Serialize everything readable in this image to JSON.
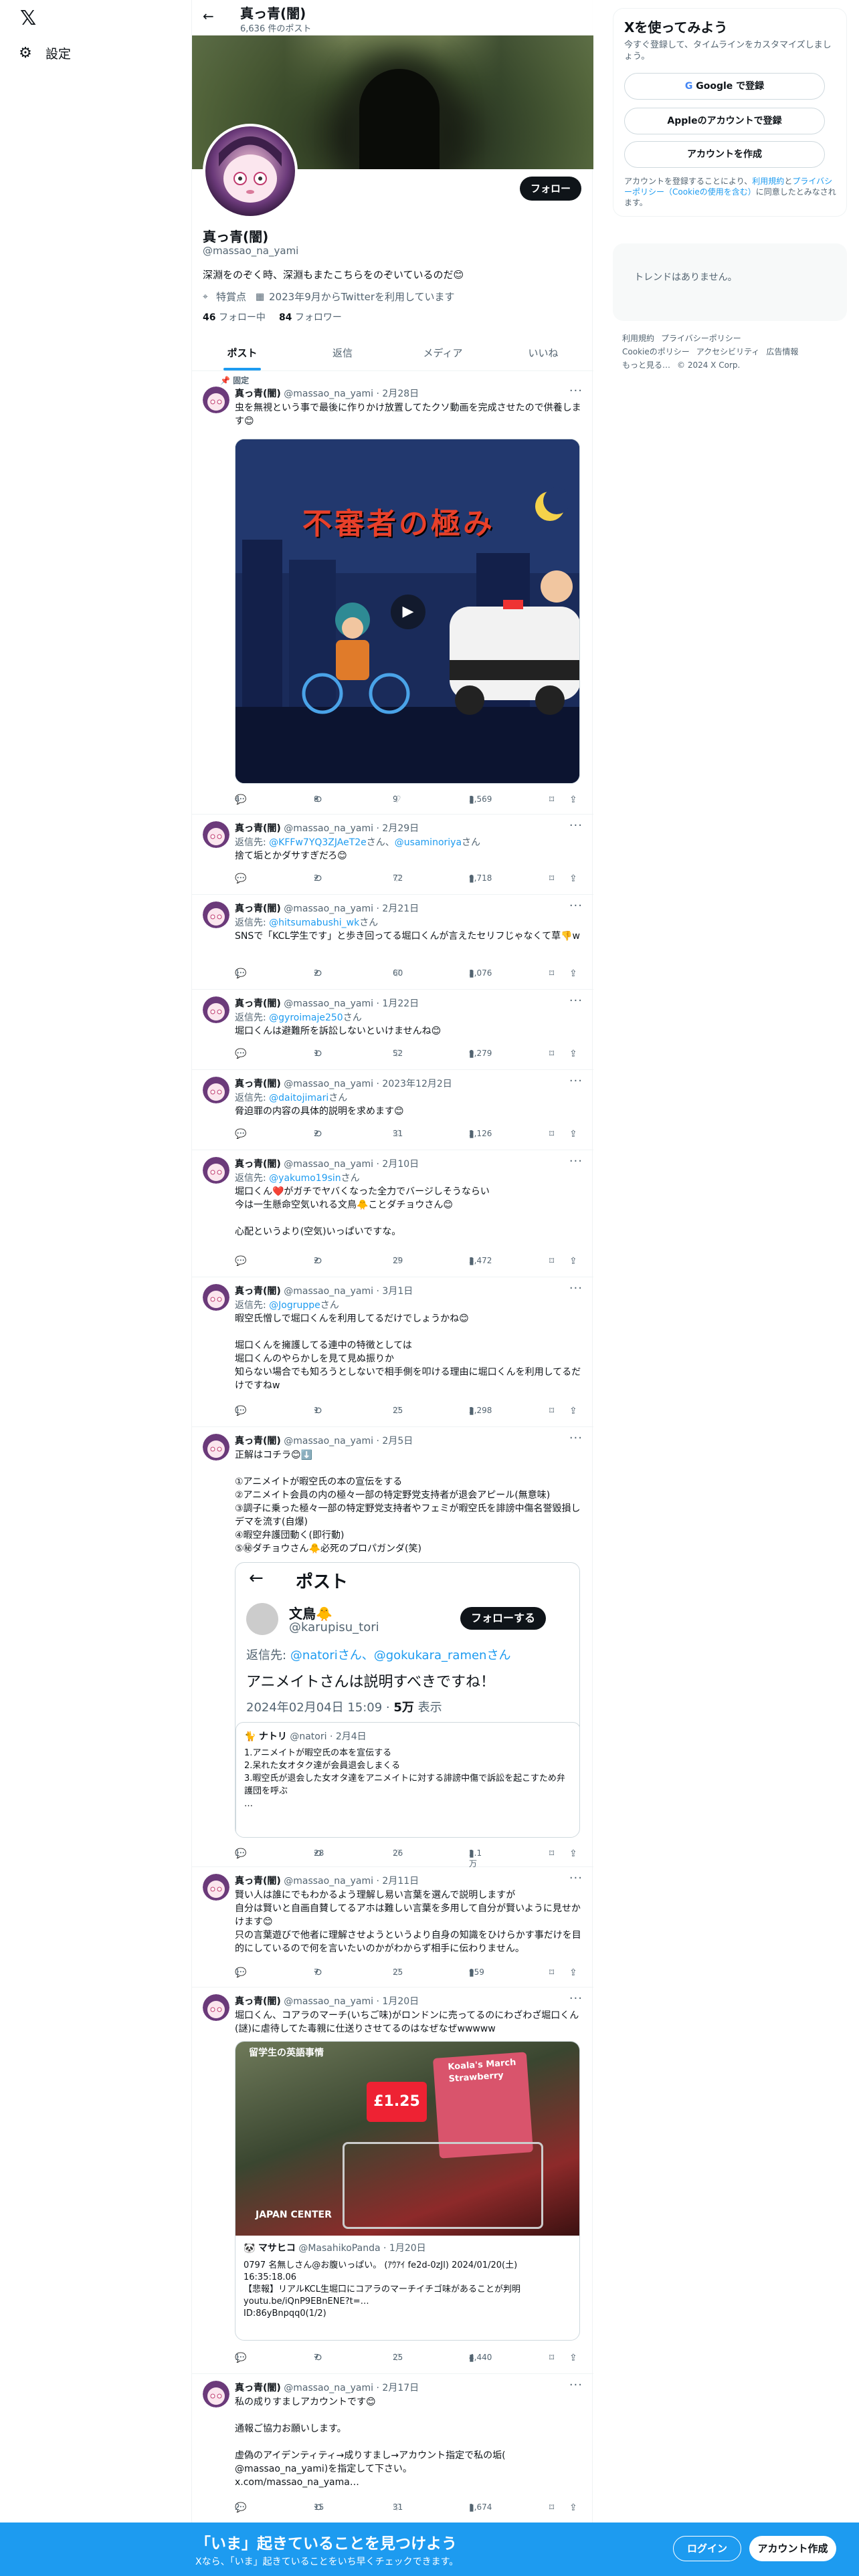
{
  "nav": {
    "settings_label": "設定"
  },
  "profile": {
    "name": "真っ青(闇)",
    "post_count": "6,636 件のポスト",
    "handle": "@massao_na_yami",
    "bio": "深淵をのぞく時、深淵もまたこちらをのぞいているのだ😊",
    "location": "特賞点",
    "joined": "2023年9月からTwitterを利用しています",
    "following_num": "46",
    "following_label": "フォロー中",
    "followers_num": "84",
    "followers_label": "フォロワー",
    "follow_button": "フォロー"
  },
  "tabs": [
    "ポスト",
    "返信",
    "メディア",
    "いいね"
  ],
  "pinned_label": "固定",
  "tweets": [
    {
      "name": "真っ青(闇)",
      "handle": "@massao_na_yami",
      "date": "2月28日",
      "reply_to": "",
      "body": "虫を無視という事で最後に作りかけ放置してたクソ動画を完成させたので供養します😊",
      "video_title": "不審者の極み",
      "replies": "4",
      "retweets": "8",
      "likes": "9",
      "views": "3,569"
    },
    {
      "name": "真っ青(闇)",
      "handle": "@massao_na_yami",
      "date": "2月29日",
      "reply_prefix": "返信先:",
      "reply_to": "@KFFw7YQ3ZJAeT2e",
      "reply_mid": "さん、",
      "reply_to2": "@usaminoriya",
      "reply_suffix": "さん",
      "body": "捨て垢とかダサすぎだろ😊",
      "replies": "",
      "retweets": "2",
      "likes": "72",
      "views": "9,718"
    },
    {
      "name": "真っ青(闇)",
      "handle": "@massao_na_yami",
      "date": "2月21日",
      "reply_prefix": "返信先:",
      "reply_to": "@hitsumabushi_wk",
      "reply_suffix": "さん",
      "body": "SNSで「KCL学生です」と歩き回ってる堀口くんが言えたセリフじゃなくて草👎w",
      "replies": "1",
      "retweets": "2",
      "likes": "60",
      "views": "3,076"
    },
    {
      "name": "真っ青(闇)",
      "handle": "@massao_na_yami",
      "date": "1月22日",
      "reply_prefix": "返信先:",
      "reply_to": "@gyroimaje250",
      "reply_suffix": "さん",
      "body": "堀口くんは避難所を訴訟しないといけませんね😊",
      "replies": "",
      "retweets": "1",
      "likes": "52",
      "views": "9,279"
    },
    {
      "name": "真っ青(闇)",
      "handle": "@massao_na_yami",
      "date": "2023年12月2日",
      "reply_prefix": "返信先:",
      "reply_to": "@daitojimari",
      "reply_suffix": "さん",
      "body": "脅迫罪の内容の具体的説明を求めます😊",
      "replies": "",
      "retweets": "2",
      "likes": "31",
      "views": "2,126"
    },
    {
      "name": "真っ青(闇)",
      "handle": "@massao_na_yami",
      "date": "2月10日",
      "reply_prefix": "返信先:",
      "reply_to": "@yakumo19sin",
      "reply_suffix": "さん",
      "body": "堀口くん❤️がガチでヤバくなった全力でバージしそうならい\n今は一生懸命空気いれる文鳥🐥ことダチョウさん😊\n\n心配というより(空気)いっぱいですな。",
      "replies": "",
      "retweets": "2",
      "likes": "29",
      "views": "3,472"
    },
    {
      "name": "真っ青(闇)",
      "handle": "@massao_na_yami",
      "date": "3月1日",
      "reply_prefix": "返信先:",
      "reply_to": "@Jogruppe",
      "reply_suffix": "さん",
      "body": "暇空氏憎しで堀口くんを利用してるだけでしょうかね😊\n\n堀口くんを擁護してる連中の特徴としては\n堀口くんのやらかしを見て見ぬ振りか\n知らない場合でも知ろうとしないで相手側を叩ける理由に堀口くんを利用してるだけですねw",
      "replies": "1",
      "retweets": "1",
      "likes": "25",
      "views": "2,298"
    },
    {
      "name": "真っ青(闇)",
      "handle": "@massao_na_yami",
      "date": "2月5日",
      "reply_to": "",
      "body": "正解はコチラ😊⬇️\n\n①アニメイトが暇空氏の本の宣伝をする\n②アニメイト会員の内の極々一部の特定野党支持者が退会アピール(無意味)\n③調子に乗った極々一部の特定野党支持者やフェミが暇空氏を誹謗中傷名誉毀損しデマを流す(自爆)\n④暇空弁護団動く(即行動)\n⑤㊙ダチョウさん🐥必死のプロパガンダ(笑)",
      "replies": "1",
      "retweets": "28",
      "likes": "26",
      "views": "2.1万"
    },
    {
      "name": "真っ青(闇)",
      "handle": "@massao_na_yami",
      "date": "2月11日",
      "reply_to": "",
      "body": "賢い人は誰にでもわかるよう理解し易い言葉を選んで説明しますが\n自分は賢いと自画自賛してるアホは難しい言葉を多用して自分が賢いように見せかけます😊\n只の言葉遊びで他者に理解させようというより自身の知識をひけらかす事だけを目的にしているので何を言いたいのかがわからず相手に伝わりません。",
      "replies": "1",
      "retweets": "7",
      "likes": "25",
      "views": "959"
    },
    {
      "name": "真っ青(闇)",
      "handle": "@massao_na_yami",
      "date": "1月20日",
      "reply_to": "",
      "body": "堀口くん、コアラのマーチ(いちご味)がロンドンに売ってるのにわざわざ堀口くん(謎)に虐待してた毒親に仕送りさせてるのはなぜなぜwwwww",
      "replies": "1",
      "retweets": "7",
      "likes": "25",
      "views": "4,440"
    },
    {
      "name": "真っ青(闇)",
      "handle": "@massao_na_yami",
      "date": "2月17日",
      "reply_to": "",
      "body": "私の成りすましアカウントです😊\n\n通報ご協力お願いします。\n\n虚偽のアイデンティティ→成りすまし→アカウント指定で私の垢(\n@massao_na_yami)を指定して下さい。\nx.com/massao_na_yama…",
      "replies": "2",
      "retweets": "15",
      "likes": "31",
      "views": "1,674"
    }
  ],
  "quote1": {
    "header": "ポスト",
    "name": "文鳥🐥",
    "handle": "@karupisu_tori",
    "follow": "フォローする",
    "reply_prefix": "返信先:",
    "reply_links": "@natoriさん、@gokukara_ramenさん",
    "text": "アニメイトさんは説明すべきですね！",
    "time": "2024年02月04日 15:09 · ",
    "views_num": "5万",
    "views_label": "表示",
    "inner_name": "ナトリ",
    "inner_handle": "@natori",
    "inner_date": "2月4日",
    "inner_text": "1.アニメイトが暇空氏の本を宣伝する\n2.呆れた女オタク達が会員退会しまくる\n3.暇空氏が退会した女オタ達をアニメイトに対する誹謗中傷で訴訟を起こすため弁護団を呼ぶ\n…"
  },
  "quote2": {
    "img_label": "留学生の英語事情",
    "img_price": "£1.25",
    "img_tag": "JAPAN CENTER",
    "img_pack": "Koala's March Strawberry",
    "name": "マサヒコ",
    "handle": "@MasahikoPanda",
    "date": "1月20日",
    "text": "0797 名無しさん@お腹いっぱい。 (ｱｳｱｲ fe2d-0zJl) 2024/01/20(土) 16:35:18.06\n【悲報】リアルKCL生堀口にコアラのマーチイチゴ味があることが判明\nyoutu.be/iQnP9EBnENE?t=…\nID:86yBnpqq0(1/2)"
  },
  "right": {
    "signup_title": "Xを使ってみよう",
    "signup_sub": "今すぐ登録して、タイムラインをカスタマイズしましょう。",
    "google_btn": "Google で登録",
    "apple_btn": "Appleのアカウントで登録",
    "create_btn": "アカウントを作成",
    "legal_pre": "アカウントを登録することにより、",
    "legal_terms": "利用規約",
    "legal_and": "と",
    "legal_privacy": "プライバシーポリシー",
    "legal_cookie": "（Cookieの使用を含む）",
    "legal_post": "に同意したとみなされます。",
    "trends_empty": "トレンドはありません。",
    "footer": [
      "利用規約",
      "プライバシーポリシー",
      "Cookieのポリシー",
      "アクセシビリティ",
      "広告情報",
      "もっと見る…",
      "© 2024 X Corp."
    ]
  },
  "bottom": {
    "title": "「いま」起きていることを見つけよう",
    "sub": "Xなら、「いま」起きていることをいち早くチェックできます。",
    "login": "ログイン",
    "signup": "アカウント作成"
  },
  "colors": {
    "accent": "#1d9bf0",
    "text": "#0f1419",
    "muted": "#536471",
    "border": "#eff3f4"
  }
}
